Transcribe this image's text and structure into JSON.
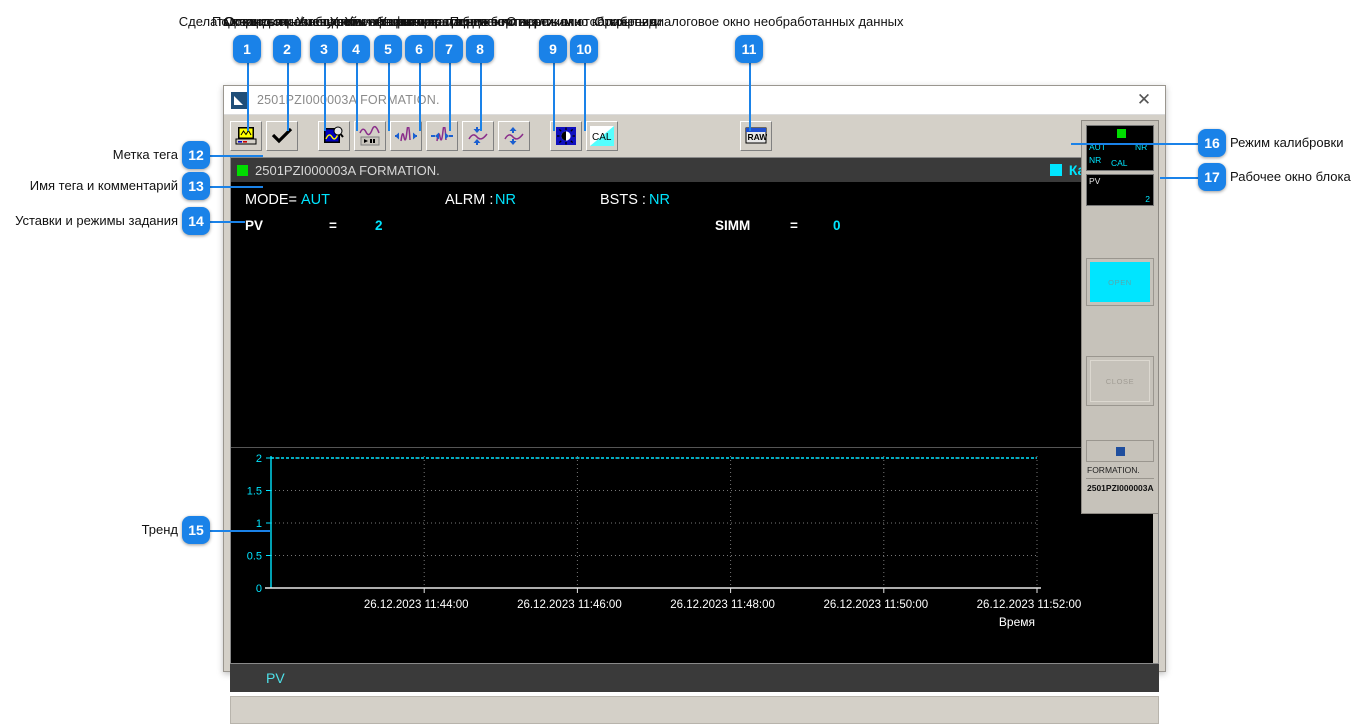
{
  "annotations": {
    "top": [
      {
        "n": "1",
        "text": "Сделать копию экрана"
      },
      {
        "n": "2",
        "text": "Подтвердить сообщение"
      },
      {
        "n": "3",
        "text": "Открыть окно настройки графика"
      },
      {
        "n": "4",
        "text": "Остановить / запустить обновление тренда"
      },
      {
        "n": "5",
        "text": "Уменьшить интервал времени"
      },
      {
        "n": "6",
        "text": "Увеличить интервал времени"
      },
      {
        "n": "7",
        "text": "Уменьшить масштаб по вертикали"
      },
      {
        "n": "8",
        "text": "Увеличить масштаб по вертикали"
      },
      {
        "n": "9",
        "text": "Переключить режим отображения"
      },
      {
        "n": "10",
        "text": "Открыть окно калибровки"
      },
      {
        "n": "11",
        "text": "Открыть диалоговое окно необработанных данных"
      }
    ],
    "left": [
      {
        "n": "12",
        "text": "Метка тега"
      },
      {
        "n": "13",
        "text": "Имя тега и комментарий"
      },
      {
        "n": "14",
        "text": "Уставки и режимы задания"
      },
      {
        "n": "15",
        "text": "Тренд"
      }
    ],
    "right": [
      {
        "n": "16",
        "text": "Режим калибровки"
      },
      {
        "n": "17",
        "text": "Рабочее окно блока"
      }
    ]
  },
  "window": {
    "title": "2501PZI000003A FORMATION.",
    "close_label": "✕"
  },
  "toolbar": {
    "buttons": [
      {
        "id": "print",
        "icon": "printer-icon"
      },
      {
        "id": "acknowledge",
        "icon": "checkmark-icon"
      },
      {
        "id": "graph-config",
        "icon": "graph-magnifier-icon"
      },
      {
        "id": "trend-pause",
        "icon": "trend-playback-icon"
      },
      {
        "id": "time-shrink",
        "icon": "wave-compress-horizontal-icon"
      },
      {
        "id": "time-expand",
        "icon": "wave-expand-horizontal-icon"
      },
      {
        "id": "scale-shrink",
        "icon": "wave-compress-vertical-icon"
      },
      {
        "id": "scale-expand",
        "icon": "wave-expand-vertical-icon"
      },
      {
        "id": "display-mode",
        "icon": "brightness-icon"
      },
      {
        "id": "calibration",
        "icon": "cal-icon",
        "label": "CAL"
      },
      {
        "id": "raw-data",
        "icon": "raw-icon",
        "label": "RAW"
      }
    ]
  },
  "tagbar": {
    "tag_name": "2501PZI000003A FORMATION.",
    "mode_label": "Калибровка"
  },
  "info": {
    "mode_key": "MODE=",
    "mode_value": "AUT",
    "alarm_key": "ALRM :",
    "alarm_value": "NR",
    "bsts_key": "BSTS :",
    "bsts_value": "NR",
    "pv_key": "PV",
    "pv_eq": "=",
    "pv_value": "2",
    "simm_key": "SIMM",
    "simm_eq": "=",
    "simm_value": "0"
  },
  "faceplate": {
    "mode": "AUT",
    "alarm": "NR",
    "bsts": "NR",
    "cal": "CAL",
    "pv_label": "PV",
    "pv_value": "2",
    "open_label": "OPEN",
    "close_label": "CLOSE",
    "comment": "FORMATION.",
    "tag": "2501PZI000003A"
  },
  "legend": {
    "pv": "PV"
  },
  "colors": {
    "accent": "#1a82e8",
    "cyan": "#00e5ff",
    "green": "#00dd00",
    "window_face": "#d4d0c8",
    "dark": "#000000"
  },
  "chart_data": {
    "type": "line",
    "title": "",
    "xlabel": "Время",
    "ylabel": "",
    "ylim": [
      0,
      2
    ],
    "yticks": [
      "0",
      "0.5",
      "1",
      "1.5",
      "2"
    ],
    "ytick_values": [
      0,
      0.5,
      1,
      1.5,
      2
    ],
    "xticks": [
      "26.12.2023 11:44:00",
      "26.12.2023 11:46:00",
      "26.12.2023 11:48:00",
      "26.12.2023 11:50:00",
      "26.12.2023 11:52:00"
    ],
    "grid": true,
    "legend_position": "bottom",
    "series": [
      {
        "name": "PV",
        "color": "#00e5ff",
        "values": [
          2,
          2,
          2,
          2,
          2,
          2,
          2,
          2,
          2,
          2,
          2,
          2,
          2,
          2,
          2,
          2,
          2,
          2,
          2,
          2,
          2
        ]
      }
    ]
  }
}
